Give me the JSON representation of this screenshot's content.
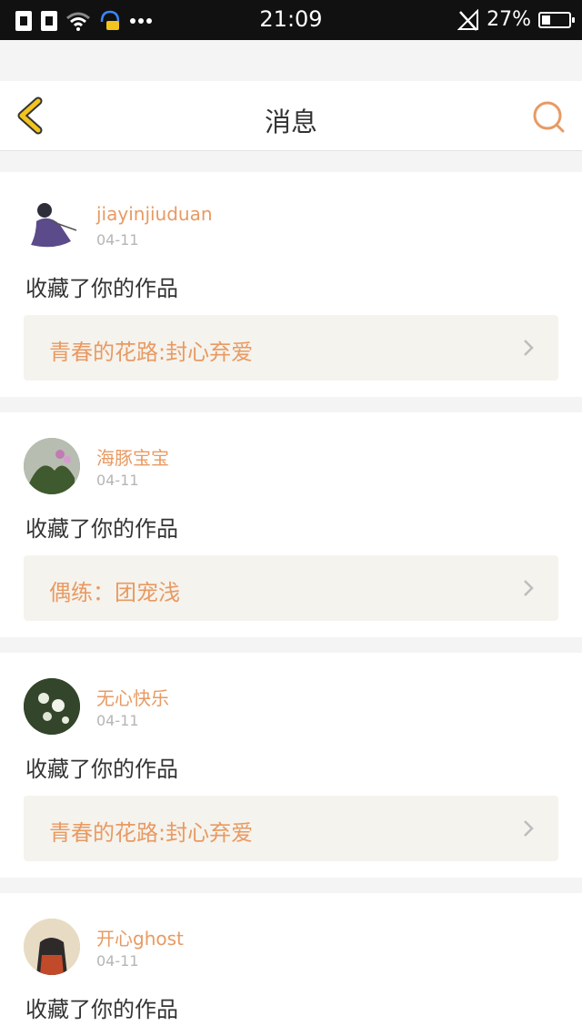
{
  "status_bar": {
    "time": "21:09",
    "battery_percent": "27%",
    "battery_level": 0.27
  },
  "header": {
    "title": "消息"
  },
  "messages": [
    {
      "username": "jiayinjiuduan",
      "date": "04-11",
      "action": "收藏了你的作品",
      "work_title": "青春的花路:封心弃爱"
    },
    {
      "username": "海豚宝宝",
      "date": "04-11",
      "action": "收藏了你的作品",
      "work_title": "偶练：团宠浅"
    },
    {
      "username": "无心快乐",
      "date": "04-11",
      "action": "收藏了你的作品",
      "work_title": "青春的花路:封心弃爱"
    },
    {
      "username": "开心ghost",
      "date": "04-11",
      "action": "收藏了你的作品",
      "work_title": ""
    }
  ],
  "colors": {
    "accent": "#e89a63",
    "back_icon": "#f2c41f",
    "work_bg": "#f5f3ed"
  },
  "icons": {
    "back": "chevron-left-icon",
    "search": "search-icon"
  }
}
